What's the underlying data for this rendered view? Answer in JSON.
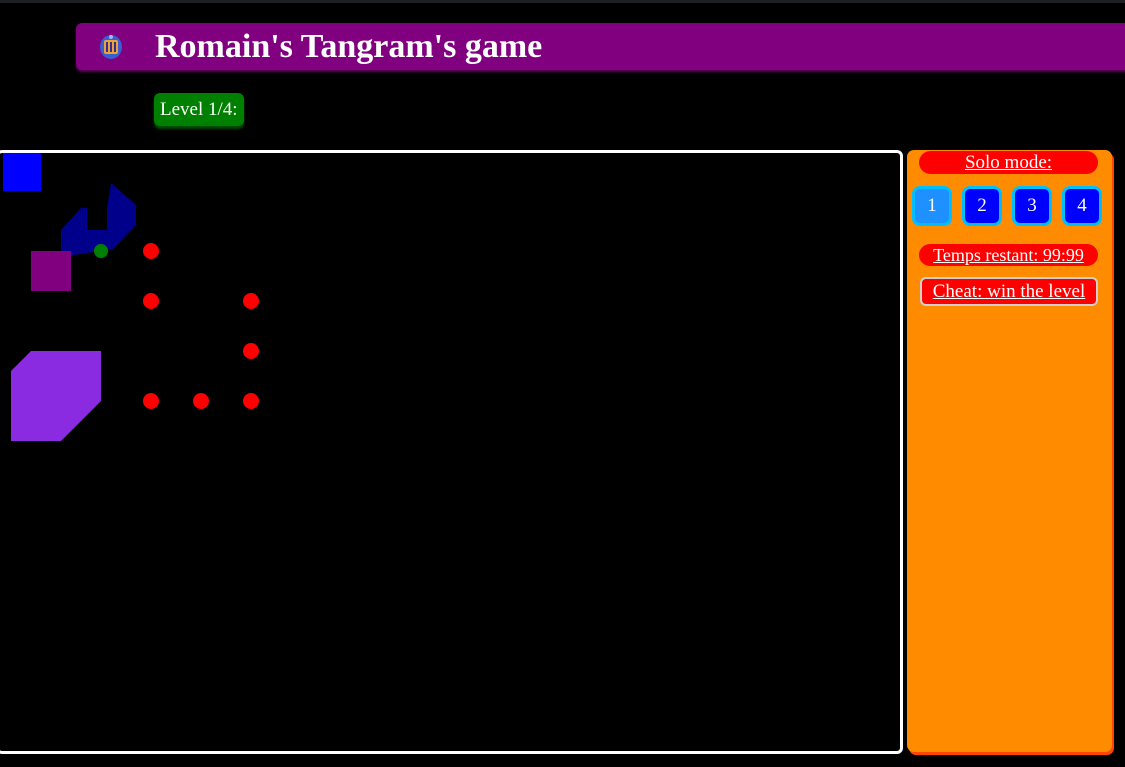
{
  "header": {
    "title": "Romain's Tangram's game",
    "logo_icon": "tangram-logo-icon"
  },
  "level": {
    "label": "Level 1/4:"
  },
  "board": {
    "pieces": [
      {
        "name": "blue-square-piece",
        "color": "#0000ff"
      },
      {
        "name": "navy-polygon-piece",
        "color": "#00008b"
      },
      {
        "name": "purple-square-piece",
        "color": "#800080"
      },
      {
        "name": "violet-octagon-piece",
        "color": "#8a2be2"
      }
    ],
    "anchor_color": "#008000",
    "target_color": "#ff0000"
  },
  "panel": {
    "mode_label": "Solo mode:",
    "level_buttons": [
      {
        "label": "1",
        "active": true
      },
      {
        "label": "2",
        "active": false
      },
      {
        "label": "3",
        "active": false
      },
      {
        "label": "4",
        "active": false
      }
    ],
    "timer_text": "Temps restant: 99:99",
    "cheat_label": "Cheat: win the level"
  },
  "colors": {
    "title_bar": "#800080",
    "level_badge": "#008000",
    "panel": "#ff8c00",
    "accent_red": "#ff0000"
  }
}
